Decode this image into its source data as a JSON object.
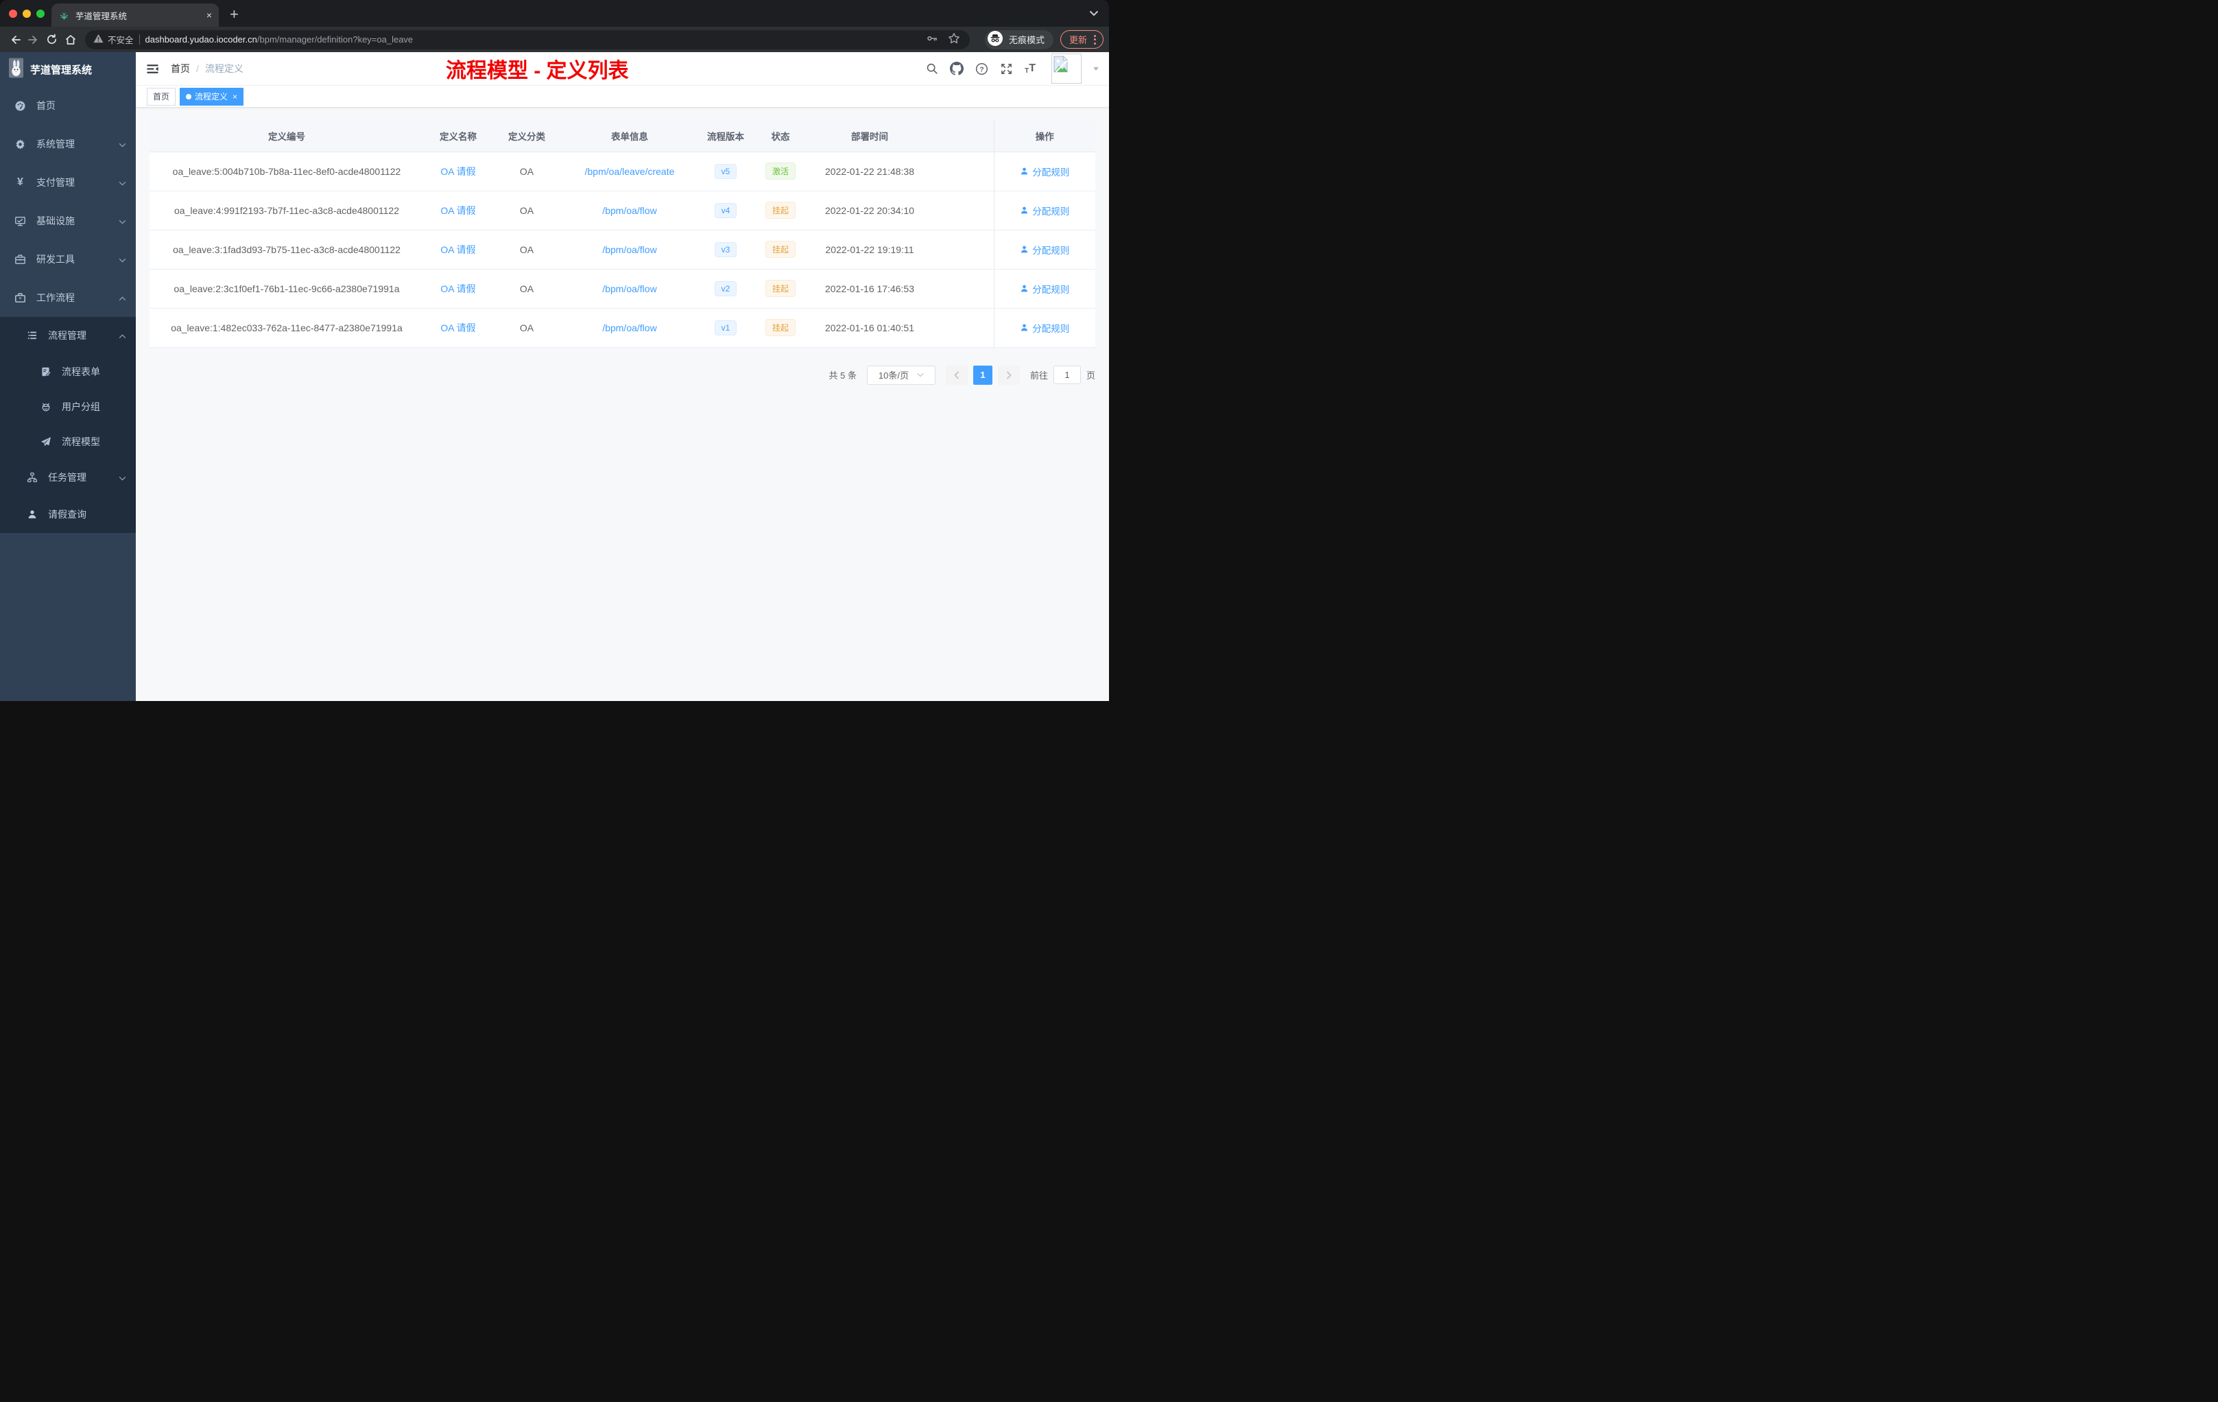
{
  "browser": {
    "tab_title": "芋道管理系统",
    "address": {
      "security_label": "不安全",
      "host": "dashboard.yudao.iocoder.cn",
      "path": "/bpm/manager/definition?key=oa_leave"
    },
    "incognito_label": "无痕模式",
    "update_label": "更新"
  },
  "sidebar": {
    "logo_title": "芋道管理系统",
    "items": [
      {
        "label": "首页",
        "icon": "dashboard-icon"
      },
      {
        "label": "系统管理",
        "icon": "gear-icon"
      },
      {
        "label": "支付管理",
        "icon": "yen-icon"
      },
      {
        "label": "基础设施",
        "icon": "monitor-icon"
      },
      {
        "label": "研发工具",
        "icon": "toolbox-icon"
      },
      {
        "label": "工作流程",
        "icon": "briefcase-icon"
      },
      {
        "label": "流程管理",
        "icon": "tree-list-icon"
      },
      {
        "label": "流程表单",
        "icon": "form-edit-icon"
      },
      {
        "label": "用户分组",
        "icon": "robot-icon"
      },
      {
        "label": "流程模型",
        "icon": "paper-plane-icon"
      },
      {
        "label": "任务管理",
        "icon": "org-tree-icon"
      },
      {
        "label": "请假查询",
        "icon": "user-icon"
      }
    ]
  },
  "header": {
    "breadcrumb": {
      "home": "首页",
      "separator": "/",
      "current": "流程定义"
    },
    "annotation": "流程模型 - 定义列表"
  },
  "tags": {
    "home": "首页",
    "active": "流程定义"
  },
  "table": {
    "columns": [
      "定义编号",
      "定义名称",
      "定义分类",
      "表单信息",
      "流程版本",
      "状态",
      "部署时间",
      "操作"
    ],
    "rows": [
      {
        "id": "oa_leave:5:004b710b-7b8a-11ec-8ef0-acde48001122",
        "name": "OA 请假",
        "category": "OA",
        "form": "/bpm/oa/leave/create",
        "version": "v5",
        "status": "激活",
        "status_type": "success",
        "time": "2022-01-22 21:48:38",
        "action": "分配规则"
      },
      {
        "id": "oa_leave:4:991f2193-7b7f-11ec-a3c8-acde48001122",
        "name": "OA 请假",
        "category": "OA",
        "form": "/bpm/oa/flow",
        "version": "v4",
        "status": "挂起",
        "status_type": "warning",
        "time": "2022-01-22 20:34:10",
        "action": "分配规则"
      },
      {
        "id": "oa_leave:3:1fad3d93-7b75-11ec-a3c8-acde48001122",
        "name": "OA 请假",
        "category": "OA",
        "form": "/bpm/oa/flow",
        "version": "v3",
        "status": "挂起",
        "status_type": "warning",
        "time": "2022-01-22 19:19:11",
        "action": "分配规则"
      },
      {
        "id": "oa_leave:2:3c1f0ef1-76b1-11ec-9c66-a2380e71991a",
        "name": "OA 请假",
        "category": "OA",
        "form": "/bpm/oa/flow",
        "version": "v2",
        "status": "挂起",
        "status_type": "warning",
        "time": "2022-01-16 17:46:53",
        "action": "分配规则"
      },
      {
        "id": "oa_leave:1:482ec033-762a-11ec-8477-a2380e71991a",
        "name": "OA 请假",
        "category": "OA",
        "form": "/bpm/oa/flow",
        "version": "v1",
        "status": "挂起",
        "status_type": "warning",
        "time": "2022-01-16 01:40:51",
        "action": "分配规则"
      }
    ]
  },
  "pagination": {
    "total": "共 5 条",
    "page_size": "10条/页",
    "page": "1",
    "goto_label": "前往",
    "goto_value": "1",
    "unit": "页"
  },
  "icons": {
    "plus": "+",
    "close": "×",
    "yen": "¥",
    "font_small": "T",
    "font_large": "T"
  },
  "colors": {
    "accent": "#409eff",
    "success": "#67c23a",
    "warning": "#e6a23c",
    "annotation_red": "#f20000",
    "sidebar_bg": "#304156",
    "submenu_bg": "#1f2d3d",
    "update_accent": "#f28b82",
    "tag_active": "#409eff"
  }
}
